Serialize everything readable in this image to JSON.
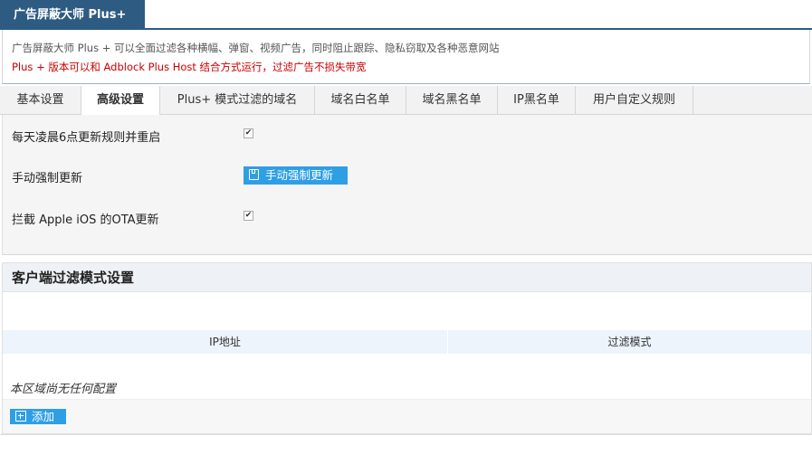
{
  "app": {
    "title": "广告屏蔽大师 Plus+"
  },
  "description": {
    "line1": "广告屏蔽大师 Plus + 可以全面过滤各种横幅、弹窗、视频广告，同时阻止跟踪、隐私窃取及各种恶意网站",
    "line2": "Plus + 版本可以和 Adblock Plus Host 结合方式运行，过滤广告不损失带宽",
    "line2_color": "#cc0000"
  },
  "tabs": [
    {
      "label": "基本设置",
      "active": false
    },
    {
      "label": "高级设置",
      "active": true
    },
    {
      "label": "Plus+ 模式过滤的域名",
      "active": false
    },
    {
      "label": "域名白名单",
      "active": false
    },
    {
      "label": "域名黑名单",
      "active": false
    },
    {
      "label": "IP黑名单",
      "active": false
    },
    {
      "label": "用户自定义规则",
      "active": false
    }
  ],
  "settings": {
    "daily_update": {
      "label": "每天凌晨6点更新规则并重启",
      "checked": true
    },
    "manual_update": {
      "label": "手动强制更新",
      "button_label": "手动强制更新",
      "button_icon": "save-icon"
    },
    "block_ios_ota": {
      "label": "拦截 Apple iOS 的OTA更新",
      "checked": true
    }
  },
  "client_filter": {
    "title": "客户端过滤模式设置",
    "columns": {
      "ip": "IP地址",
      "mode": "过滤模式"
    },
    "empty_message": "本区域尚无任何配置",
    "add_button_label": "添加",
    "add_button_icon": "plus-icon"
  },
  "colors": {
    "brand": "#2e5b82",
    "accent_button": "#2f9fe5"
  }
}
